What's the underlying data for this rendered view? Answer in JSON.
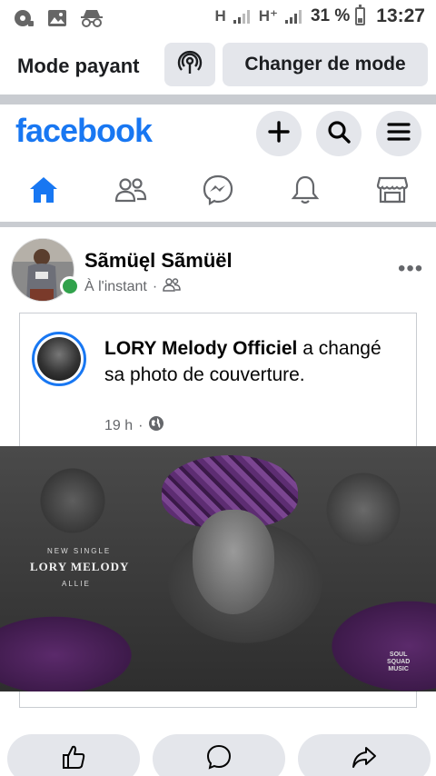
{
  "status_bar": {
    "net1": "H",
    "net2": "H⁺",
    "battery": "31 %",
    "time": "13:27",
    "battery_level": 0.31,
    "icons": [
      "cd-icon",
      "image-icon",
      "incognito-icon"
    ]
  },
  "mode_bar": {
    "label": "Mode payant",
    "change_button": "Changer de mode",
    "icon": "broadcast-icon"
  },
  "header": {
    "logo": "facebook",
    "buttons": [
      "plus-icon",
      "search-icon",
      "menu-icon"
    ],
    "accent_color": "#1877f2"
  },
  "tabs": [
    {
      "name": "home",
      "icon": "home-icon",
      "active": true
    },
    {
      "name": "friends",
      "icon": "friends-icon",
      "active": false
    },
    {
      "name": "messenger",
      "icon": "messenger-icon",
      "active": false
    },
    {
      "name": "notifications",
      "icon": "bell-icon",
      "active": false
    },
    {
      "name": "marketplace",
      "icon": "marketplace-icon",
      "active": false
    }
  ],
  "post": {
    "author": "Sãmüęl Sãmüël",
    "time": "À l'instant",
    "separator": "·",
    "audience_icon": "friends-icon",
    "more": "•••",
    "shared": {
      "page_name": "LORY Melody Officiel",
      "action_text": " a changé sa photo de couverture.",
      "time": "19 h",
      "separator": "·",
      "audience_icon": "globe-icon"
    },
    "cover": {
      "line1": "NEW SINGLE",
      "line2": "LORY MELODY",
      "line3": "ALLIE",
      "logo_l1": "SOUL",
      "logo_l2": "SQUAD",
      "logo_l3": "MUSIC"
    }
  },
  "actions": [
    "like-icon",
    "comment-icon",
    "share-icon"
  ]
}
